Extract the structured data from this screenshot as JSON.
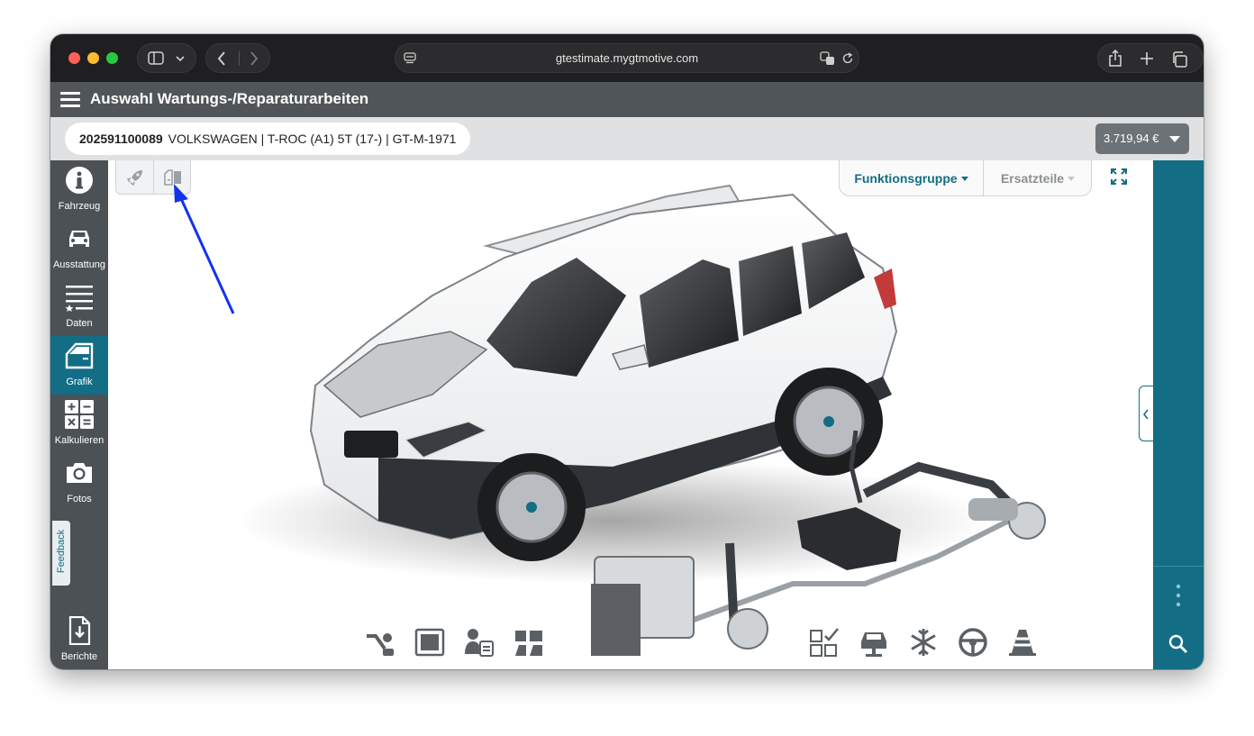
{
  "browser": {
    "url": "gtestimate.mygtmotive.com"
  },
  "header": {
    "title": "Auswahl Wartungs-/Reparaturarbeiten"
  },
  "vehicle": {
    "id": "202591100089",
    "description": "VOLKSWAGEN | T-ROC (A1) 5T (17-) | GT-M-1971",
    "price": "3.719,94 €"
  },
  "sidebar": {
    "items": [
      {
        "label": "Fahrzeug",
        "icon": "info-icon"
      },
      {
        "label": "Ausstattung",
        "icon": "car-front-icon"
      },
      {
        "label": "Daten",
        "icon": "list-star-icon"
      },
      {
        "label": "Grafik",
        "icon": "car-door-icon",
        "active": true
      },
      {
        "label": "Kalkulieren",
        "icon": "calculator-icon"
      },
      {
        "label": "Fotos",
        "icon": "camera-icon"
      },
      {
        "label": "Berichte",
        "icon": "report-download-icon"
      }
    ],
    "feedback_label": "Feedback"
  },
  "main": {
    "tabs": [
      {
        "label": "Funktionsgruppe",
        "active": true
      },
      {
        "label": "Ersatzteile",
        "active": false
      }
    ],
    "toolbar_icons": [
      "rocket-icon",
      "door-panel-icon"
    ],
    "bottom_icons_left": [
      "wiper-icon",
      "window-icon",
      "person-seat-icon",
      "seat-icon"
    ],
    "bottom_icons_right": [
      "checklist-grid-icon",
      "car-lift-icon",
      "snowflake-icon",
      "steering-wheel-icon",
      "traffic-cone-icon"
    ]
  },
  "colors": {
    "accent": "#136d85",
    "header_bg": "#505559",
    "sidebar_bg": "#4b5155",
    "annotation_arrow": "#1133ee"
  }
}
